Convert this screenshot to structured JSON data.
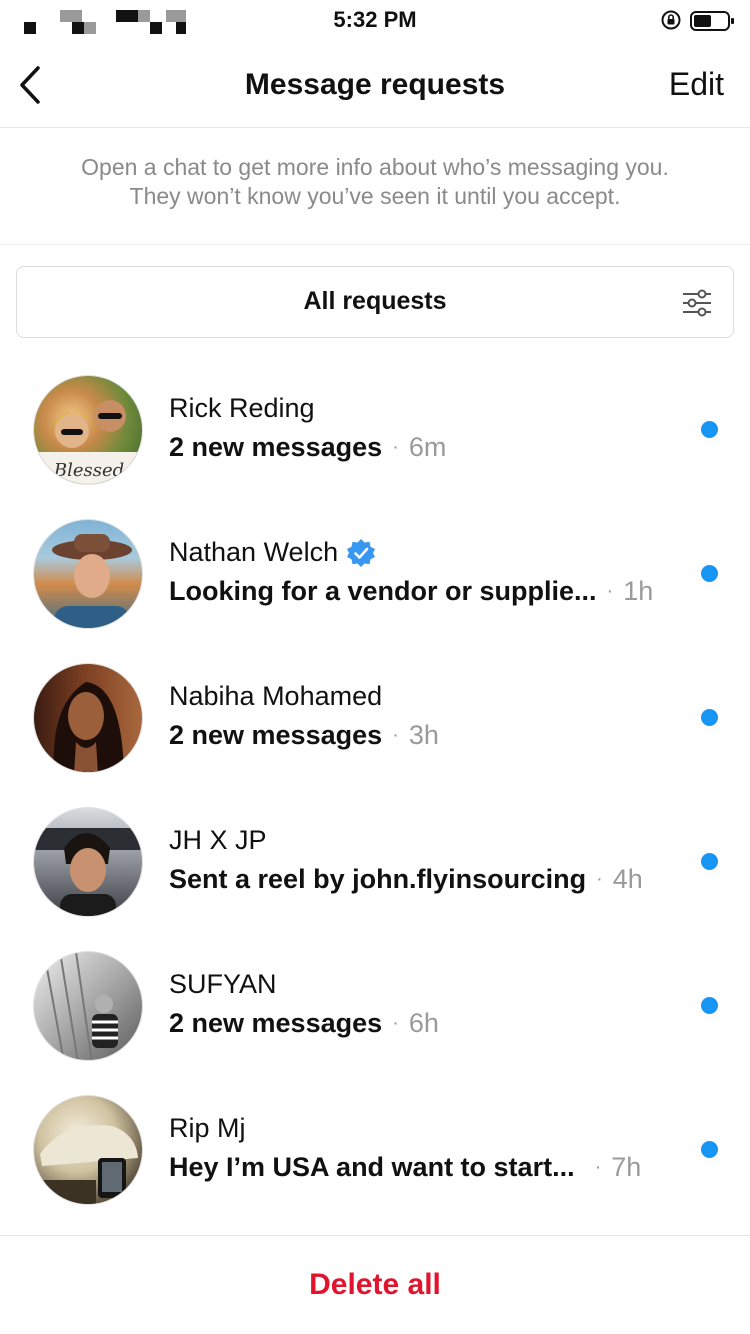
{
  "status_bar": {
    "time": "5:32 PM"
  },
  "nav": {
    "title": "Message requests",
    "edit_label": "Edit"
  },
  "info": {
    "line1": "Open a chat to get more info about who’s messaging you.",
    "line2": "They won’t know you’ve seen it until you accept."
  },
  "filter": {
    "label": "All requests",
    "icon": "sliders-icon"
  },
  "requests": [
    {
      "name": "Rick Reding",
      "preview": "2 new messages",
      "time": "6m",
      "verified": false,
      "unread": true
    },
    {
      "name": "Nathan Welch",
      "preview": "Looking for a vendor or supplie...",
      "time": "1h",
      "verified": true,
      "unread": true
    },
    {
      "name": "Nabiha Mohamed",
      "preview": "2 new messages",
      "time": "3h",
      "verified": false,
      "unread": true
    },
    {
      "name": "JH X JP",
      "preview": "Sent a reel by john.flyinsourcing",
      "time": "4h",
      "verified": false,
      "unread": true
    },
    {
      "name": "SUFYAN",
      "preview": "2 new messages",
      "time": "6h",
      "verified": false,
      "unread": true
    },
    {
      "name": "Rip Mj",
      "preview": "Hey I’m USA and want to start...",
      "time": "7h",
      "verified": false,
      "unread": true
    }
  ],
  "avatar_overlay_text": "Blessed",
  "separator": "·",
  "footer": {
    "delete_all_label": "Delete all"
  },
  "colors": {
    "accent_blue": "#1896f5",
    "destructive_red": "#e0142c",
    "secondary_text": "#8a8a8a"
  }
}
